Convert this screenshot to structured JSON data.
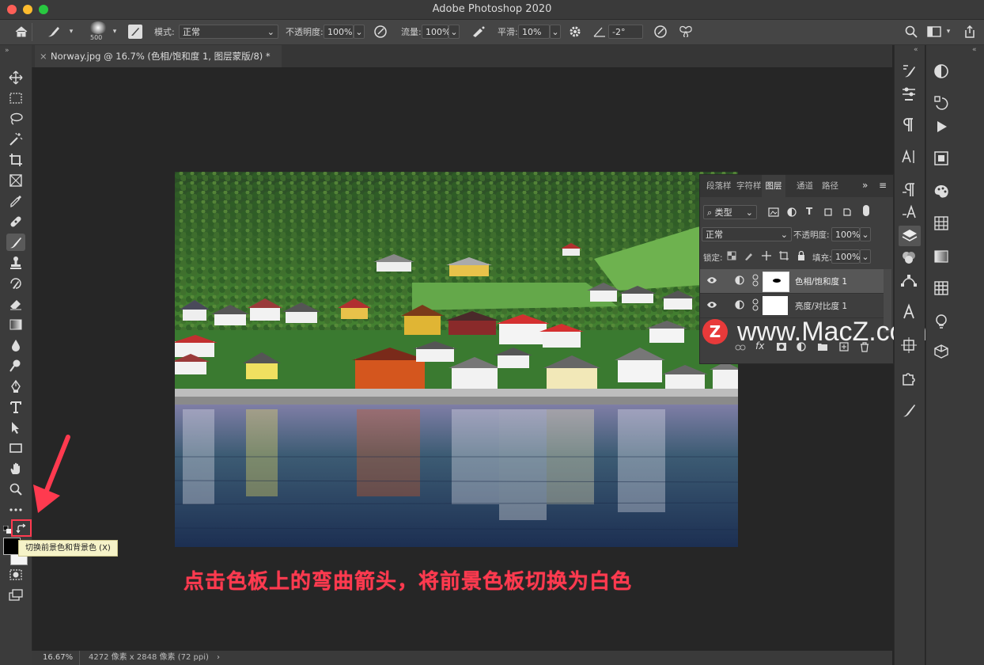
{
  "window": {
    "title": "Adobe Photoshop 2020"
  },
  "options_bar": {
    "brush_size": "500",
    "mode_label": "模式:",
    "mode_value": "正常",
    "opacity_label": "不透明度:",
    "opacity_value": "100%",
    "flow_label": "流量:",
    "flow_value": "100%",
    "smoothing_label": "平滑:",
    "smoothing_value": "10%",
    "angle_value": "-2°"
  },
  "document_tab": {
    "label": "Norway.jpg @ 16.7% (色相/饱和度 1, 图层蒙版/8) *"
  },
  "layers_panel": {
    "tabs": [
      "段落样",
      "字符样",
      "图层",
      "通道",
      "路径"
    ],
    "active_tab": "图层",
    "filter_kind": "类型",
    "blend_mode": "正常",
    "opacity_label": "不透明度:",
    "opacity_value": "100%",
    "lock_label": "锁定:",
    "fill_label": "填充:",
    "fill_value": "100%",
    "layers": [
      {
        "name": "色相/饱和度 1",
        "selected": true
      },
      {
        "name": "亮度/对比度 1",
        "selected": false
      }
    ]
  },
  "tooltip": {
    "text": "切换前景色和背景色 (X)"
  },
  "annotation": {
    "text": "点击色板上的弯曲箭头，将前景色板切换为白色"
  },
  "watermark": {
    "badge": "Z",
    "text": "www.MacZ.com"
  },
  "status_bar": {
    "zoom": "16.67%",
    "doc_info": "4272 像素 x 2848 像素 (72 ppi)"
  },
  "colors": {
    "accent_red": "#ff3a4f",
    "ui_dark": "#3a3a3a",
    "canvas_bg": "#262626"
  }
}
